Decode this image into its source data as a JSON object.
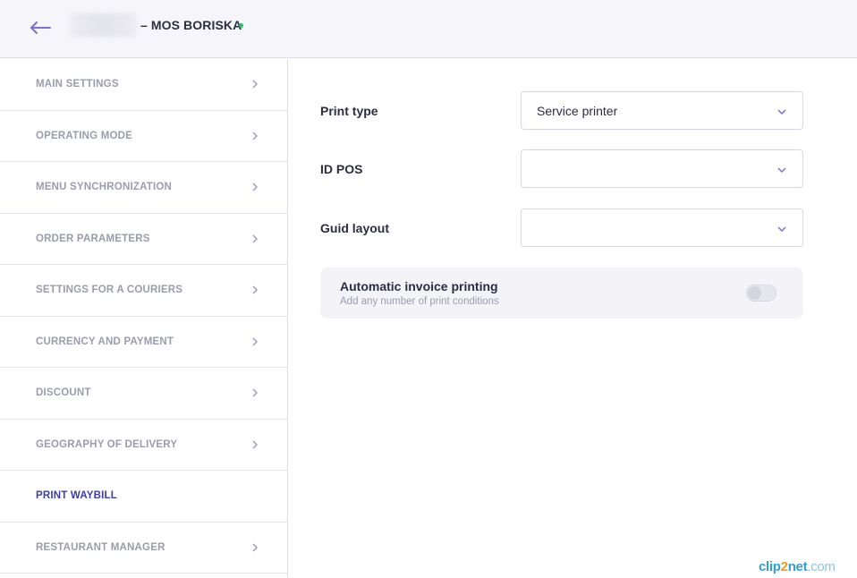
{
  "header": {
    "store_name": "– MOS BORISKA",
    "status_color": "#22c55e",
    "back_icon": "arrow-left-icon"
  },
  "sidebar": {
    "items": [
      {
        "label": "MAIN SETTINGS",
        "active": false
      },
      {
        "label": "OPERATING MODE",
        "active": false
      },
      {
        "label": "MENU SYNCHRONIZATION",
        "active": false
      },
      {
        "label": "ORDER PARAMETERS",
        "active": false
      },
      {
        "label": "SETTINGS FOR A COURIERS",
        "active": false
      },
      {
        "label": "CURRENCY AND PAYMENT",
        "active": false
      },
      {
        "label": "DISCOUNT",
        "active": false
      },
      {
        "label": "GEOGRAPHY OF DELIVERY",
        "active": false
      },
      {
        "label": "PRINT WAYBILL",
        "active": true
      },
      {
        "label": "RESTAURANT MANAGER",
        "active": false
      }
    ]
  },
  "main": {
    "print_type": {
      "label": "Print type",
      "value": "Service printer"
    },
    "id_pos": {
      "label": "ID POS",
      "value": ""
    },
    "guid_layout": {
      "label": "Guid layout",
      "value": ""
    },
    "auto_invoice": {
      "title": "Automatic invoice printing",
      "subtitle": "Add any number of print conditions",
      "enabled": false
    }
  },
  "watermark": {
    "part1": "clip",
    "part2": "2",
    "part3": "net",
    "part4": ".com"
  },
  "colors": {
    "accent": "#3c3cb4",
    "back_arrow": "#7b6fd8",
    "muted": "#9a9cae"
  }
}
